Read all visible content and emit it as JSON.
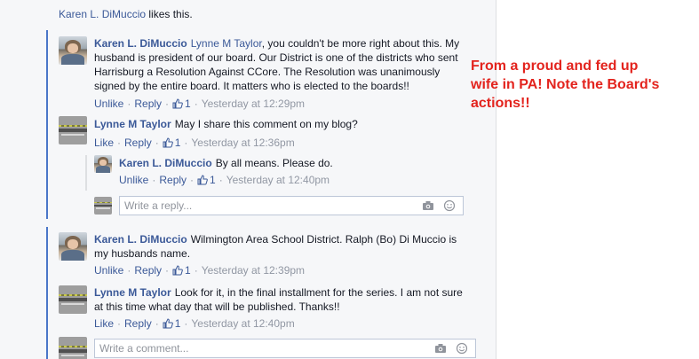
{
  "header_like": {
    "name": "Karen L. DiMuccio",
    "suffix": " likes this."
  },
  "comments": [
    {
      "author": "Karen L. DiMuccio",
      "mention": "Lynne M Taylor",
      "line1": ", you couldn't be more right about this. My",
      "line2": "husband is president of our board. Our District is one of the districts who sent",
      "line3": "Harrisburg a Resolution Against CCore. The Resolution was unanimously",
      "line4": "signed by the entire board. It matters who is elected to the boards!!",
      "actions": {
        "first": "Unlike",
        "reply": "Reply",
        "likes": "1",
        "time": "Yesterday at 12:29pm"
      }
    },
    {
      "author": "Lynne M Taylor",
      "text": "May I share this comment on my blog?",
      "actions": {
        "first": "Like",
        "reply": "Reply",
        "likes": "1",
        "time": "Yesterday at 12:36pm"
      }
    },
    {
      "author": "Karen L. DiMuccio",
      "text": "By all means. Please do.",
      "actions": {
        "first": "Unlike",
        "reply": "Reply",
        "likes": "1",
        "time": "Yesterday at 12:40pm"
      }
    },
    {
      "author": "Karen L. DiMuccio",
      "line1": "Wilmington Area School District. Ralph (Bo) Di Muccio is",
      "line2": "my husbands name.",
      "actions": {
        "first": "Unlike",
        "reply": "Reply",
        "likes": "1",
        "time": "Yesterday at 12:39pm"
      }
    },
    {
      "author": "Lynne M Taylor",
      "line1": "Look for it, in the final installment for the series. I am not sure",
      "line2": "at this time what day that will be published. Thanks!!",
      "actions": {
        "first": "Like",
        "reply": "Reply",
        "likes": "1",
        "time": "Yesterday at 12:40pm"
      }
    }
  ],
  "reply_box": {
    "placeholder": "Write a reply..."
  },
  "comment_box": {
    "placeholder": "Write a comment..."
  },
  "annotation": {
    "line1": "From a proud and fed up",
    "line2": "wife in PA! Note the Board's",
    "line3": "actions!!",
    "color": "#e3241e"
  },
  "colors": {
    "link": "#3b5998",
    "thread_bar": "#4a76c8",
    "muted": "#9197a3"
  },
  "icons": {
    "like": "thumbs-up-icon",
    "camera": "camera-icon",
    "emoji": "emoji-icon"
  }
}
